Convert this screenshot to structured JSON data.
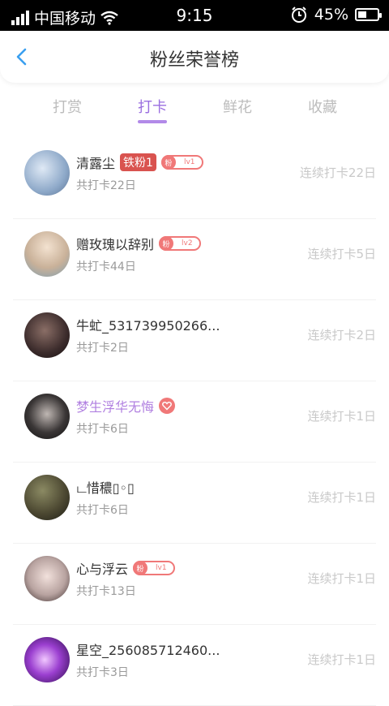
{
  "status_bar": {
    "carrier": "中国移动",
    "time": "9:15",
    "battery": "45%",
    "battery_level": 0.45
  },
  "header": {
    "title": "粉丝荣誉榜"
  },
  "tabs": [
    {
      "label": "打赏"
    },
    {
      "label": "打卡"
    },
    {
      "label": "鲜花"
    },
    {
      "label": "收藏"
    }
  ],
  "rows": [
    {
      "name": "清露尘",
      "badge_iron": "铁粉1",
      "fan_badge": {
        "label": "粉",
        "level": "lv1"
      },
      "total": "共打卡22日",
      "streak": "连续打卡22日"
    },
    {
      "name": "赠玫瑰以辞别",
      "fan_badge": {
        "label": "粉",
        "level": "lv2"
      },
      "total": "共打卡44日",
      "streak": "连续打卡5日"
    },
    {
      "name": "牛虻_531739950266...",
      "total": "共打卡2日",
      "streak": "连续打卡2日"
    },
    {
      "name": "梦生浮华无悔",
      "total": "共打卡6日",
      "streak": "连续打卡1日"
    },
    {
      "name": "ட惜穠▯◦▯",
      "total": "共打卡6日",
      "streak": "连续打卡1日"
    },
    {
      "name": "心与浮云",
      "fan_badge": {
        "label": "粉",
        "level": "lv1"
      },
      "total": "共打卡13日",
      "streak": "连续打卡1日"
    },
    {
      "name": "星空_256085712460...",
      "total": "共打卡3日",
      "streak": "连续打卡1日"
    }
  ],
  "colors": {
    "accent": "#9b6fe0",
    "fan_badge": "#f07878",
    "iron_badge": "#d9534f"
  }
}
